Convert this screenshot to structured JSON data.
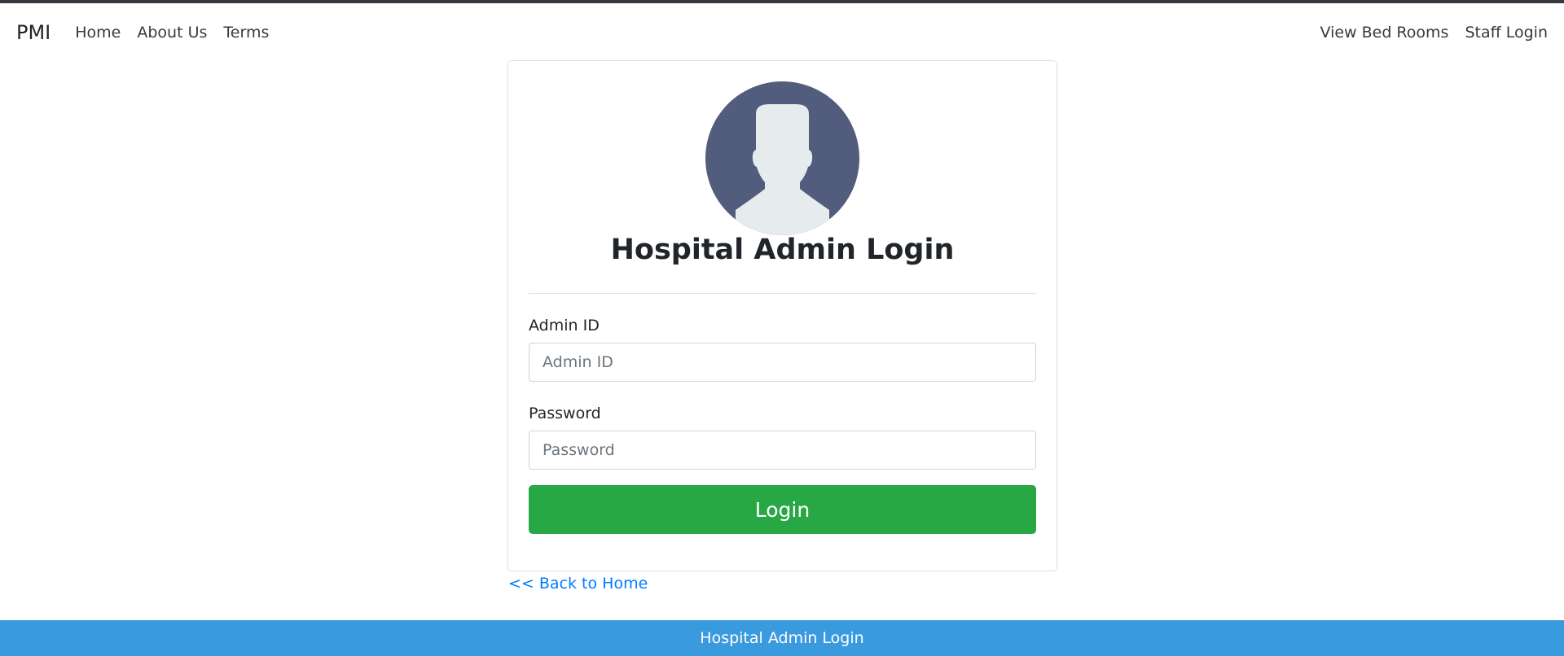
{
  "nav": {
    "brand": "PMI",
    "left_links": [
      "Home",
      "About Us",
      "Terms"
    ],
    "right_links": [
      "View Bed Rooms",
      "Staff Login"
    ]
  },
  "login": {
    "title": "Hospital Admin Login",
    "admin_id_label": "Admin ID",
    "admin_id_value": "",
    "admin_id_placeholder": "Admin ID",
    "password_label": "Password",
    "password_value": "",
    "password_placeholder": "Password",
    "button_label": "Login",
    "avatar_icon": "user-avatar-icon"
  },
  "back_link": "<< Back to Home",
  "footer": {
    "text": "Hospital Admin Login"
  },
  "colors": {
    "accent_button": "#28a745",
    "footer_bg": "#3a9ade",
    "link": "#007bff",
    "avatar_bg": "#525d7d",
    "avatar_figure": "#e6ebed"
  }
}
